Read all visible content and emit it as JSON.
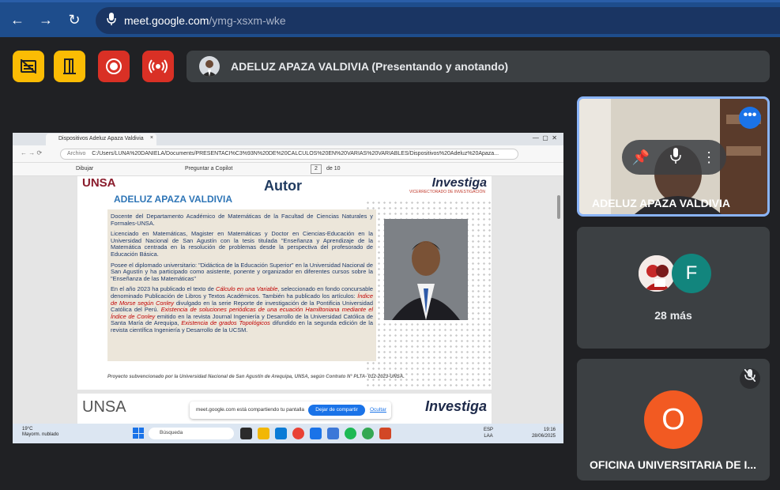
{
  "browser": {
    "url_host": "meet.google.com",
    "url_path": "/ymg-xsxm-wke"
  },
  "presenter": {
    "label": "ADELUZ APAZA VALDIVIA (Presentando y anotando)"
  },
  "screen": {
    "tab_title": "Dispositivos Adeluz Apaza Valdivia",
    "address_prefix": "Archivo",
    "address": "C:/Users/LUNA%20DANIELA/Documents/PRESENTACI%C3%93N%20DE%20CALCULOS%20EN%20VARIAS%20VARIABLES/Dispositivos%20Adeluz%20Apaza...",
    "toolbar": {
      "draw": "Dibujar",
      "ask": "Preguntar a Copilot",
      "page_num": "2",
      "page_total": "de 10"
    },
    "slide": {
      "unsa": "UNSA",
      "investiga": "Investiga",
      "vicerrectorado": "VICERRECTORADO DE INVESTIGACIÓN",
      "autor": "Autor",
      "name": "ADELUZ APAZA VALDIVIA",
      "p1": "Docente del Departamento Académico de Matemáticas  de la Facultad de Ciencias Naturales y Formales-UNSA.",
      "p2": "Licenciado en Matemáticas,  Magister en Matemáticas y  Doctor en Ciencias-Educación en la Universidad Nacional de San Agustín con la tesis titulada \"Enseñanza y Aprendizaje de la Matemática centrada en la resolución de problemas desde la perspectiva del profesorado de Educación Básica.",
      "p3": "Posee el diplomado universitario: \"Didáctica de la Educación Superior\" en la Universidad Nacional de San Agustín y ha participado como asistente, ponente y organizador en diferentes cursos sobre la \"Enseñanza de las Matemáticas\"",
      "p4a": "En el año 2023 ha publicado el texto de ",
      "p4b": "Cálculo en una Variable",
      "p4c": ", seleccionado en fondo concursable denominado Publicación de Libros y Textos Académicos. También ha publicado los artículos: ",
      "p4d": "Índice de Morse según Conley",
      "p4e": " divulgado en la serie Reporte de investigación de la Pontificia Universidad Católica del Perú. ",
      "p4f": "Existencia de soluciones periódicas de una ecuación Hamiltoniana mediante el Índice de Conley",
      "p4g": " emitido en la revista Journal Ingeniería y Desarrollo de la Universidad Católica de Santa María de Arequipa, ",
      "p4h": "Existencia de grados Topológicos",
      "p4i": " difundido en la segunda edición de la revista científica Ingeniería y Desarrollo  de la UCSM.",
      "footer": "Proyecto subvencionado por la Universidad Nacional de San Agustín de Arequipa, UNSA, según Contrato N° PLTA- 012-2023-UNSA."
    },
    "share_notice": {
      "message": "meet.google.com está compartiendo tu pantalla",
      "stop": "Dejar de compartir",
      "hide": "Ocultar"
    },
    "taskbar": {
      "temp": "19°C",
      "weather": "Mayorm. nublado",
      "search": "Búsqueda",
      "lang1": "ESP",
      "lang2": "LAA",
      "time": "19:16",
      "date": "28/06/2025"
    }
  },
  "tiles": {
    "t1_name": "ADELUZ APAZA VALDIVIA",
    "t2_avatar_letter": "F",
    "t2_more": "28 más",
    "t3_avatar_letter": "O",
    "t3_name": "OFICINA UNIVERSITARIA DE I..."
  },
  "colors": {
    "accent_blue": "#1a73e8",
    "control_yellow": "#fbbc04",
    "control_red": "#d93025",
    "tile_bg": "#3c4043"
  }
}
